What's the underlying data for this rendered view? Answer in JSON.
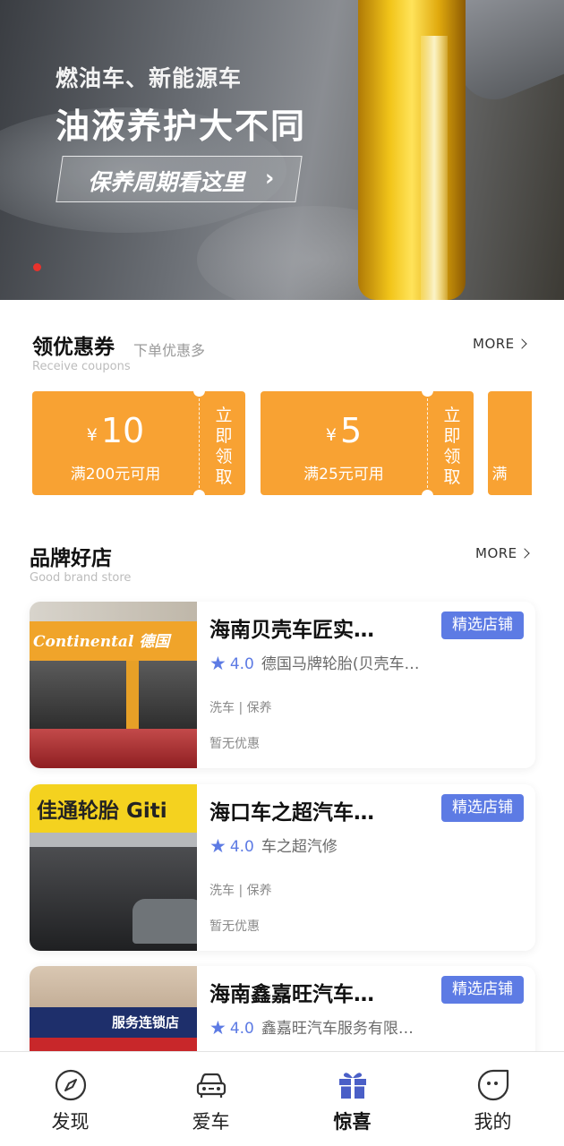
{
  "banner": {
    "subtitle": "燃油车、新能源车",
    "title": "油液养护大不同",
    "cta_label": "保养周期看这里",
    "cta_arrow": "›",
    "active_indicator_color": "#e8322c"
  },
  "coupons_section": {
    "title": "领优惠券",
    "subtitle": "下单优惠多",
    "en_label": "Receive coupons",
    "more_label": "MORE",
    "items": [
      {
        "currency": "¥",
        "amount": "10",
        "condition": "满200元可用",
        "claim_label": "立即领取"
      },
      {
        "currency": "¥",
        "amount": "5",
        "condition": "满25元可用",
        "claim_label": "立即领取"
      },
      {
        "currency": "",
        "amount": "",
        "condition": "满",
        "claim_label": ""
      }
    ]
  },
  "stores_section": {
    "title": "品牌好店",
    "en_label": "Good brand store",
    "more_label": "MORE",
    "items": [
      {
        "name": "海南贝壳车匠实…",
        "badge": "精选店铺",
        "rating": "4.0",
        "subname": "德国马牌轮胎(贝壳车…",
        "tags": "洗车 | 保养",
        "promo": "暂无优惠",
        "photo_sign": "Continental 德国"
      },
      {
        "name": "海口车之超汽车…",
        "badge": "精选店铺",
        "rating": "4.0",
        "subname": "车之超汽修",
        "tags": "洗车 | 保养",
        "promo": "暂无优惠",
        "photo_sign": "佳通轮胎 Giti"
      },
      {
        "name": "海南鑫嘉旺汽车…",
        "badge": "精选店铺",
        "rating": "4.0",
        "subname": "鑫嘉旺汽车服务有限…",
        "tags": "",
        "promo": "",
        "photo_sign": "服务连锁店"
      }
    ]
  },
  "tabbar": {
    "items": [
      {
        "label": "发现",
        "icon": "compass-icon",
        "active": false
      },
      {
        "label": "爱车",
        "icon": "car-icon",
        "active": false
      },
      {
        "label": "惊喜",
        "icon": "gift-icon",
        "active": true
      },
      {
        "label": "我的",
        "icon": "profile-icon",
        "active": false
      }
    ]
  },
  "colors": {
    "coupon_bg": "#f8a233",
    "badge_bg": "#5d7be4",
    "star": "#5d7be4",
    "tab_active_icon": "#4a5fc7"
  }
}
